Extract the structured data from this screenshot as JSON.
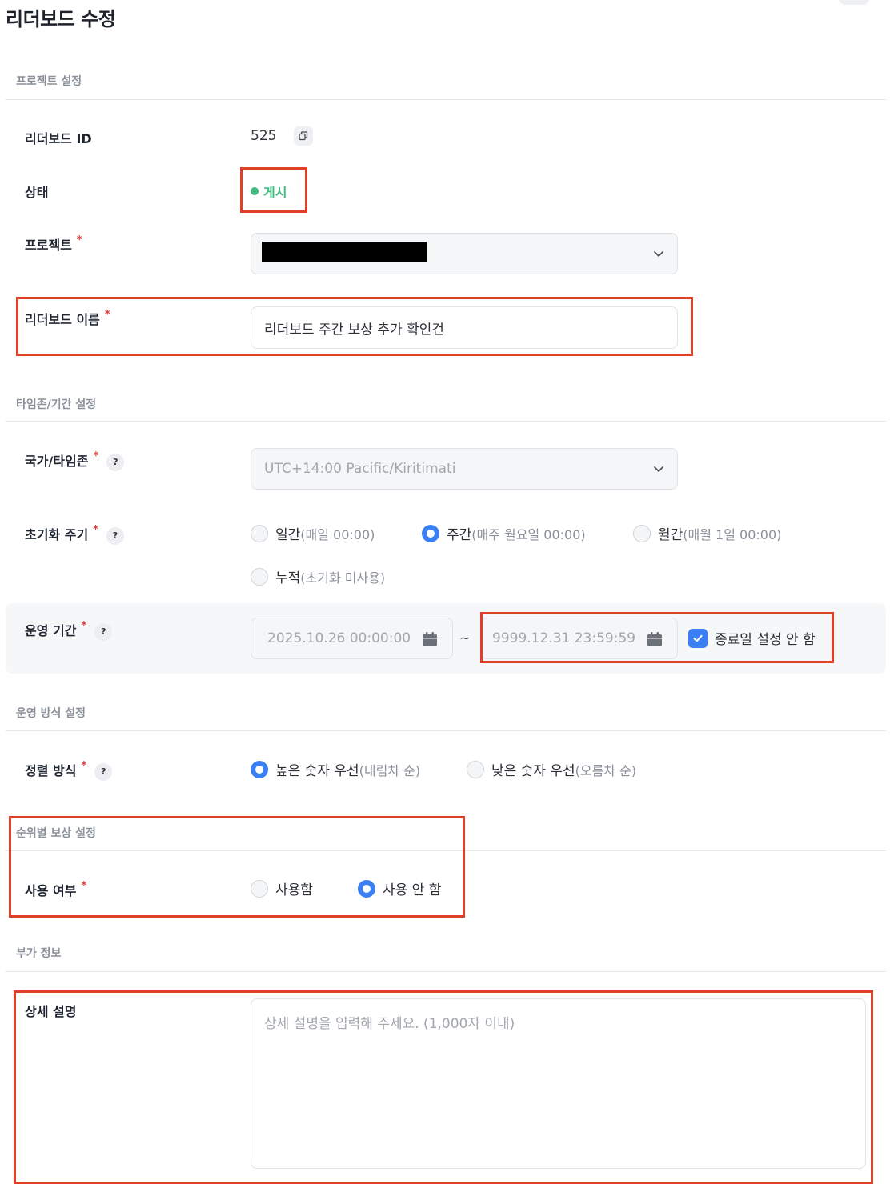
{
  "page": {
    "title": "리더보드 수정"
  },
  "sections": {
    "project": "프로젝트 설정",
    "timezone": "타임존/기간 설정",
    "operation": "운영 방식 설정",
    "rank_reward": "순위별 보상 설정",
    "extra": "부가 정보"
  },
  "fields": {
    "leaderboard_id": {
      "label": "리더보드 ID",
      "value": "525"
    },
    "status": {
      "label": "상태",
      "value": "게시",
      "color": "#43b97f"
    },
    "project": {
      "label": "프로젝트",
      "required_mark": "*",
      "value_redacted": true
    },
    "name": {
      "label": "리더보드 이름",
      "required_mark": "*",
      "value": "리더보드 주간 보상 추가 확인건"
    },
    "timezone": {
      "label": "국가/타임존",
      "required_mark": "*",
      "help": "?",
      "value": "UTC+14:00 Pacific/Kiritimati"
    },
    "reset_cycle": {
      "label": "초기화 주기",
      "required_mark": "*",
      "help": "?",
      "options": [
        {
          "main": "일간",
          "sub": "(매일 00:00)",
          "selected": false
        },
        {
          "main": "주간",
          "sub": "(매주 월요일 00:00)",
          "selected": true
        },
        {
          "main": "월간",
          "sub": "(매월 1일 00:00)",
          "selected": false
        },
        {
          "main": "누적",
          "sub": "(초기화 미사용)",
          "selected": false
        }
      ]
    },
    "period": {
      "label": "운영 기간",
      "required_mark": "*",
      "help": "?",
      "start": "2025.10.26 00:00:00",
      "separator": "~",
      "end": "9999.12.31 23:59:59",
      "no_end_label": "종료일 설정 안 함",
      "no_end_checked": true
    },
    "sort": {
      "label": "정렬 방식",
      "required_mark": "*",
      "help": "?",
      "options": [
        {
          "main": "높은 숫자 우선",
          "sub": "(내림차 순)",
          "selected": true
        },
        {
          "main": "낮은 숫자 우선",
          "sub": "(오름차 순)",
          "selected": false
        }
      ]
    },
    "reward_use": {
      "label": "사용 여부",
      "required_mark": "*",
      "options": [
        {
          "main": "사용함",
          "selected": false
        },
        {
          "main": "사용 안 함",
          "selected": true
        }
      ]
    },
    "description": {
      "label": "상세 설명",
      "placeholder": "상세 설명을 입력해 주세요. (1,000자 이내)"
    }
  },
  "colors": {
    "accent": "#3b7ff5",
    "annotation": "#e04028",
    "required": "#e03a3a"
  },
  "icons": {
    "copy": "copy-icon",
    "chevron": "chevron-down-icon",
    "calendar": "calendar-icon",
    "check": "check-icon"
  }
}
